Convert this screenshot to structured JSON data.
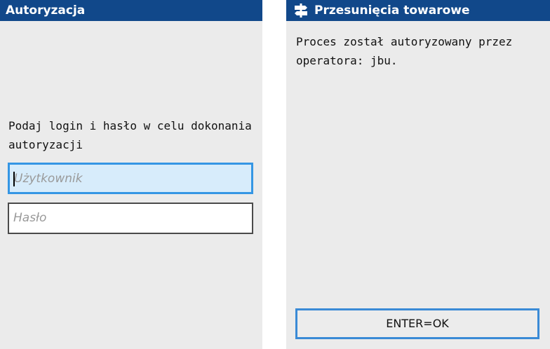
{
  "auth_panel": {
    "title": "Autoryzacja",
    "prompt": "Podaj login i hasło w celu dokonania autoryzacji",
    "username": {
      "placeholder": "Użytkownik",
      "value": ""
    },
    "password": {
      "placeholder": "Hasło",
      "value": ""
    }
  },
  "transfer_panel": {
    "title": "Przesunięcia towarowe",
    "icon": "signpost-icon",
    "message": "Proces został autoryzowany przez operatora: jbu.",
    "enter_button_label": "ENTER=OK"
  },
  "colors": {
    "titlebar": "#11488a",
    "panel_background": "#ebebeb",
    "focus_border": "#3596e4",
    "focus_fill": "#d7ecfb"
  }
}
